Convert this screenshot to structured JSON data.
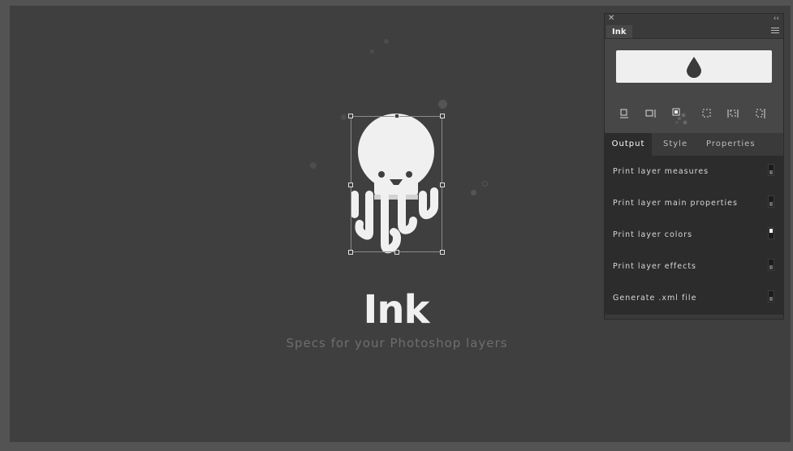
{
  "app": {
    "title": "Ink",
    "tagline": "Specs for your Photoshop layers"
  },
  "panel": {
    "tab_label": "Ink",
    "close_glyph": "✕",
    "collapse_glyph": "‹‹",
    "spec_button_icon": "drop-icon",
    "tools": [
      "measure-bottom-icon",
      "measure-right-icon",
      "measure-layer-icon",
      "measure-dashed-icon",
      "measure-dashed-horizontal-icon",
      "measure-dashed-vertical-icon"
    ],
    "tabs": [
      "Output",
      "Style",
      "Properties"
    ],
    "active_tab": "Output",
    "options": [
      {
        "label": "Print layer measures",
        "enabled": false
      },
      {
        "label": "Print layer main properties",
        "enabled": false
      },
      {
        "label": "Print layer colors",
        "enabled": true
      },
      {
        "label": "Print layer effects",
        "enabled": false
      },
      {
        "label": "Generate .xml file",
        "enabled": false
      }
    ]
  },
  "colors": {
    "workspace": "#535353",
    "canvas": "#3f3f3f",
    "mascot": "#f0f0f0",
    "panel": "#474747",
    "panel_dark": "#2c2c2c"
  }
}
